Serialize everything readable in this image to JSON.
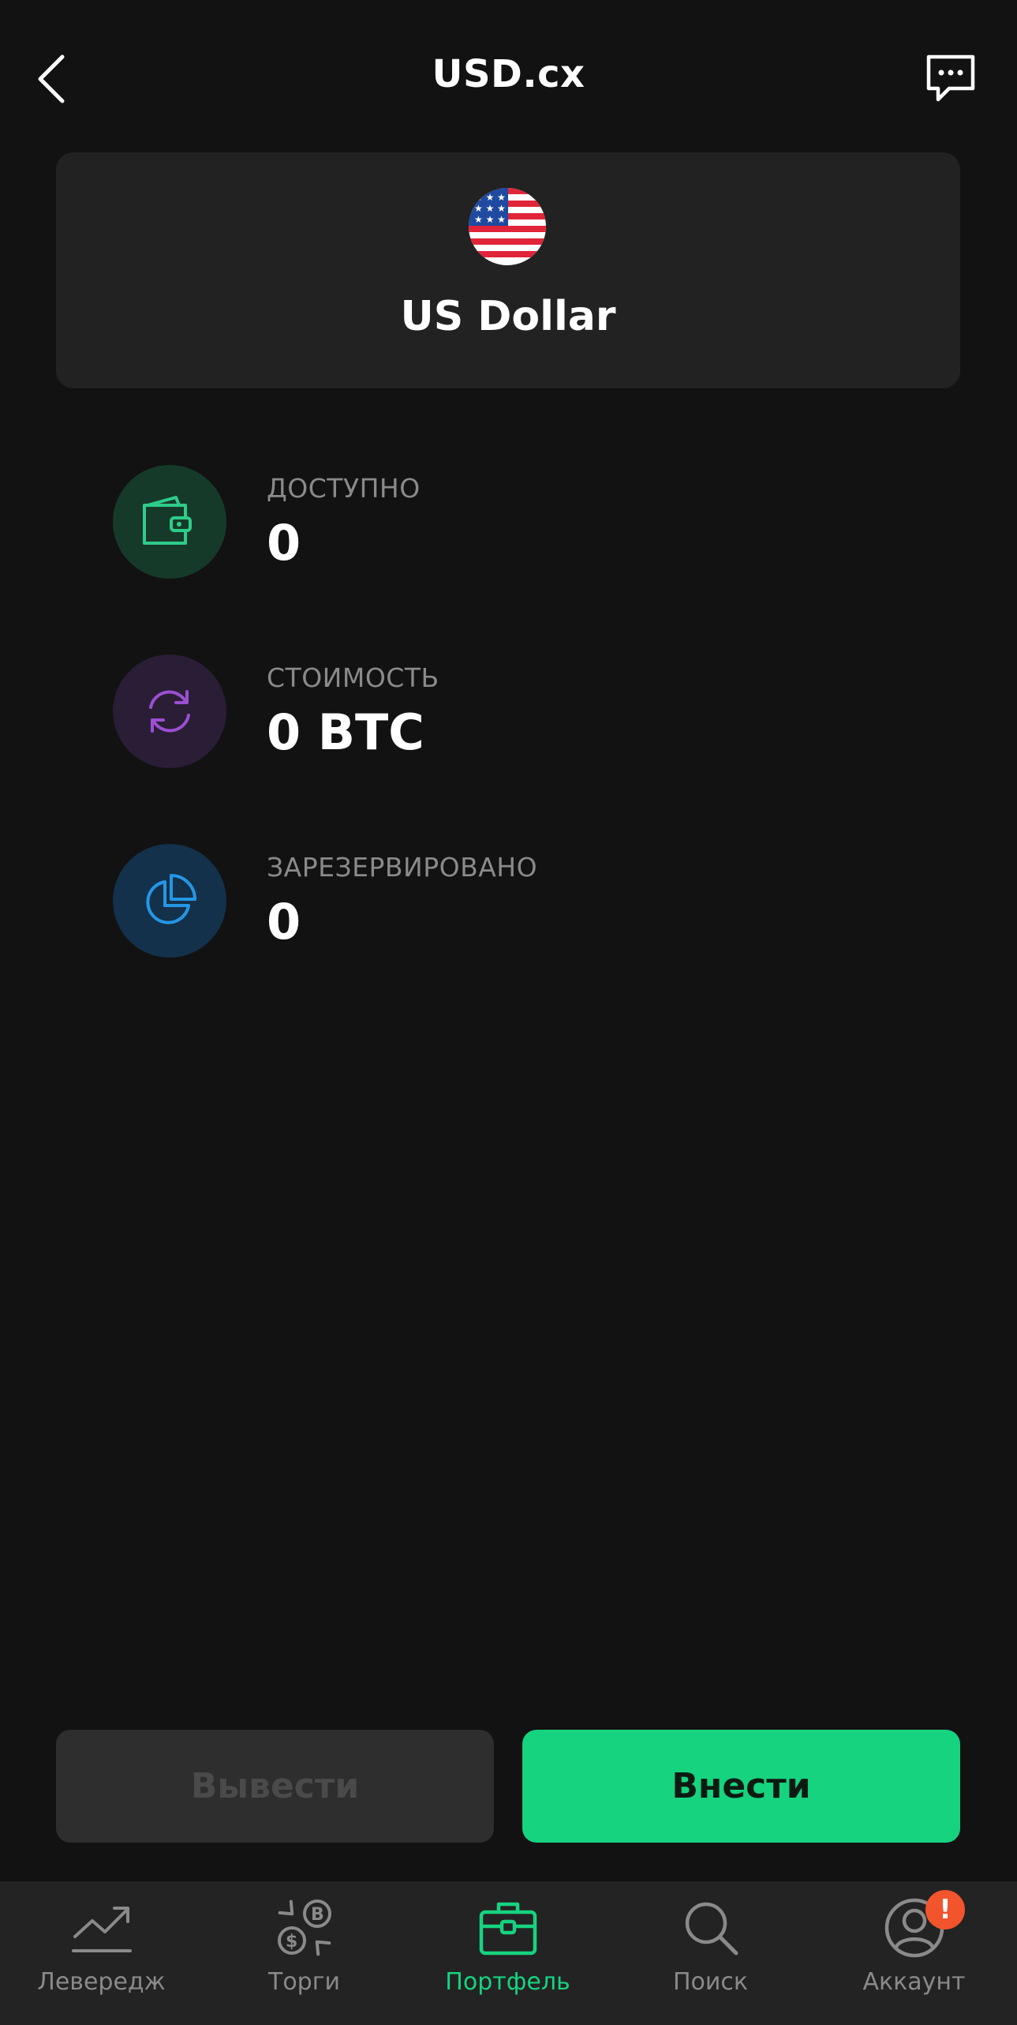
{
  "header": {
    "title": "USD.cx"
  },
  "asset": {
    "name": "US Dollar",
    "flag_icon": "us-flag-icon"
  },
  "stats": [
    {
      "label": "ДОСТУПНО",
      "value": "0",
      "icon": "wallet-icon",
      "color": "#2ecc8a",
      "bg": "#163a2a"
    },
    {
      "label": "СТОИМОСТЬ",
      "value": "0 BTC",
      "icon": "exchange-arrows-icon",
      "color": "#9b4fd1",
      "bg": "#2a1d36"
    },
    {
      "label": "ЗАРЕЗЕРВИРОВАНО",
      "value": "0",
      "icon": "pie-chart-icon",
      "color": "#2596e6",
      "bg": "#13314a"
    }
  ],
  "actions": {
    "withdraw_label": "Вывести",
    "deposit_label": "Внести"
  },
  "tabs": [
    {
      "label": "Левередж",
      "icon": "trend-chart-icon",
      "active": false
    },
    {
      "label": "Торги",
      "icon": "currency-exchange-icon",
      "active": false
    },
    {
      "label": "Портфель",
      "icon": "briefcase-icon",
      "active": true
    },
    {
      "label": "Поиск",
      "icon": "search-icon",
      "active": false
    },
    {
      "label": "Аккаунт",
      "icon": "user-icon",
      "active": false
    }
  ],
  "account_badge": "!",
  "colors": {
    "background": "#121212",
    "card": "#222222",
    "accent": "#16d37f",
    "badge": "#f2542d"
  }
}
